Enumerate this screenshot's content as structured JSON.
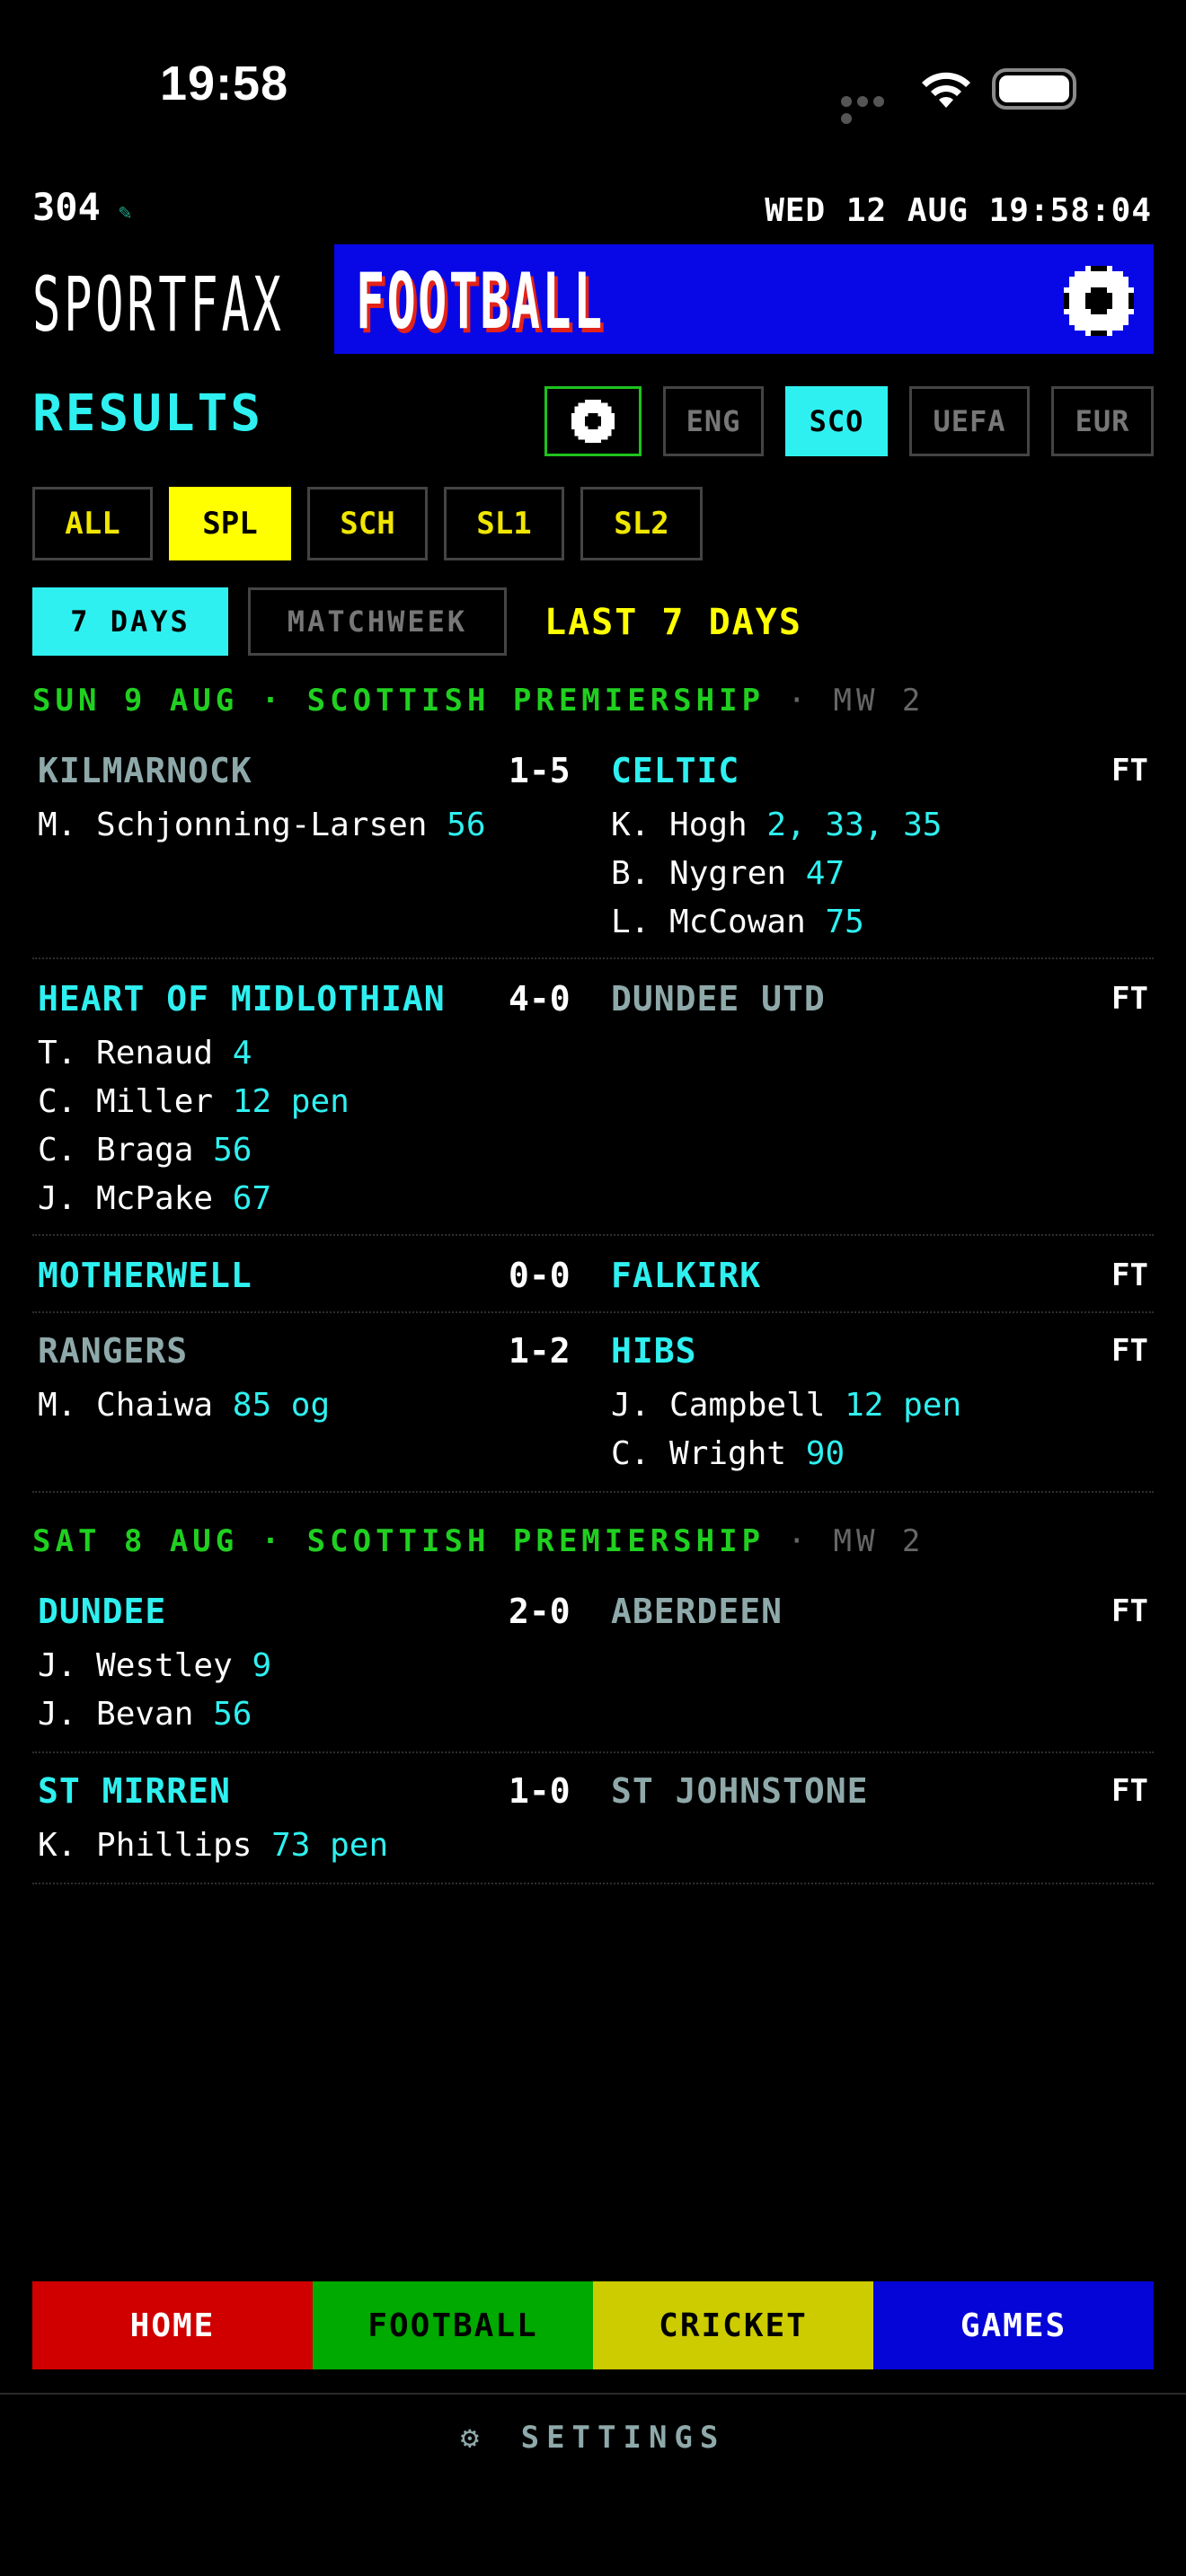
{
  "status_bar": {
    "time": "19:58"
  },
  "page_number": "304",
  "datetime": "WED 12 AUG 19:58:04",
  "brand": "SPORTFAX",
  "banner_title": "FOOTBALL",
  "results_title": "RESULTS",
  "region_tabs": [
    "ENG",
    "SCO",
    "UEFA",
    "EUR"
  ],
  "region_active": "SCO",
  "competition_filters": [
    "ALL",
    "SPL",
    "SCH",
    "SL1",
    "SL2"
  ],
  "competition_active": "SPL",
  "modes": [
    "7 DAYS",
    "MATCHWEEK"
  ],
  "range_label": "LAST 7 DAYS",
  "sections": [
    {
      "date": "SUN 9 AUG",
      "competition": "SCOTTISH PREMIERSHIP",
      "mw": "MW 2",
      "matches": [
        {
          "home": "KILMARNOCK",
          "score": "1-5",
          "away": "CELTIC",
          "status": "FT",
          "home_scorers": [
            {
              "name": "M. Schjonning-Larsen",
              "mins": "56"
            }
          ],
          "away_scorers": [
            {
              "name": "K. Hogh",
              "mins": "2, 33, 35"
            },
            {
              "name": "B. Nygren",
              "mins": "47"
            },
            {
              "name": "L. McCowan",
              "mins": "75"
            }
          ]
        },
        {
          "home": "HEART OF MIDLOTHIAN",
          "score": "4-0",
          "away": "DUNDEE UTD",
          "status": "FT",
          "home_scorers": [
            {
              "name": "T. Renaud",
              "mins": "4"
            },
            {
              "name": "C. Miller",
              "mins": "12 pen"
            },
            {
              "name": "C. Braga",
              "mins": "56"
            },
            {
              "name": "J. McPake",
              "mins": "67"
            }
          ],
          "away_scorers": []
        },
        {
          "home": "MOTHERWELL",
          "score": "0-0",
          "away": "FALKIRK",
          "status": "FT",
          "home_scorers": [],
          "away_scorers": []
        },
        {
          "home": "RANGERS",
          "score": "1-2",
          "away": "HIBS",
          "status": "FT",
          "home_scorers": [
            {
              "name": "M. Chaiwa",
              "mins": "85 og"
            }
          ],
          "away_scorers": [
            {
              "name": "J. Campbell",
              "mins": "12 pen"
            },
            {
              "name": "C. Wright",
              "mins": "90"
            }
          ]
        }
      ]
    },
    {
      "date": "SAT 8 AUG",
      "competition": "SCOTTISH PREMIERSHIP",
      "mw": "MW 2",
      "matches": [
        {
          "home": "DUNDEE",
          "score": "2-0",
          "away": "ABERDEEN",
          "status": "FT",
          "home_scorers": [
            {
              "name": "J. Westley",
              "mins": "9"
            },
            {
              "name": "J. Bevan",
              "mins": "56"
            }
          ],
          "away_scorers": []
        },
        {
          "home": "ST MIRREN",
          "score": "1-0",
          "away": "ST JOHNSTONE",
          "status": "FT",
          "home_scorers": [
            {
              "name": "K. Phillips",
              "mins": "73 pen"
            }
          ],
          "away_scorers": []
        }
      ]
    }
  ],
  "bottom_nav": [
    "HOME",
    "FOOTBALL",
    "CRICKET",
    "GAMES"
  ],
  "settings_label": "SETTINGS",
  "colors": {
    "accent": "#2ff0f0",
    "banner": "#0808e6",
    "section_green": "#20d020",
    "filter_yellow": "#ffff00"
  }
}
